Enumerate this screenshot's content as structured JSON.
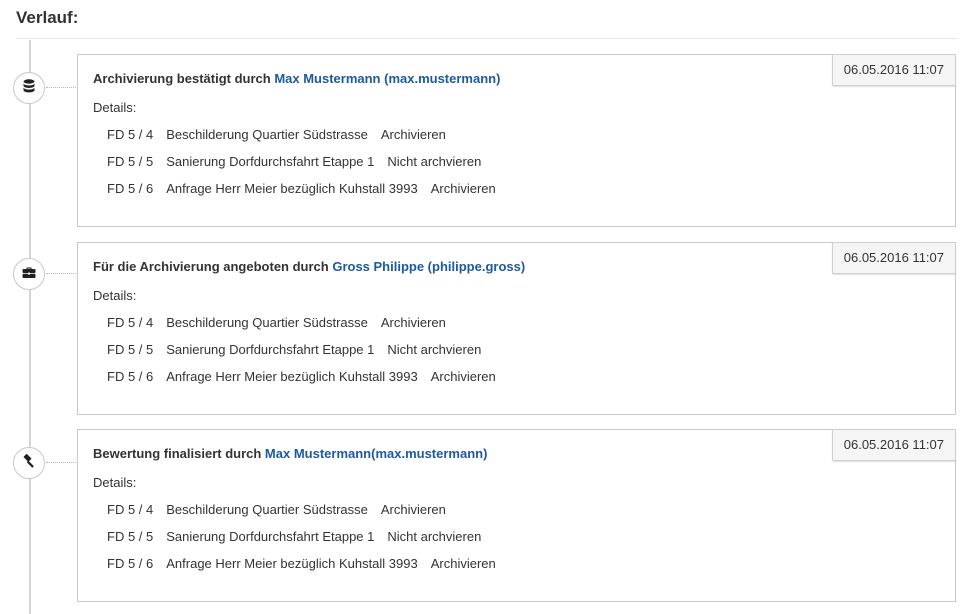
{
  "page": {
    "heading": "Verlauf:"
  },
  "entries": [
    {
      "icon": "database-icon",
      "action_text": "Archivierung bestätigt durch ",
      "user": "Max Mustermann (max.mustermann)",
      "timestamp": "06.05.2016 11:07",
      "details_label": "Details:",
      "rows": [
        {
          "code": "FD 5 / 4",
          "title": "Beschilderung Quartier Südstrasse",
          "decision": "Archivieren"
        },
        {
          "code": "FD 5 / 5",
          "title": "Sanierung Dorfdurchsfahrt Etappe 1",
          "decision": "Nicht archvieren"
        },
        {
          "code": "FD 5 / 6",
          "title": "Anfrage Herr Meier bezüglich Kuhstall 3993",
          "decision": "Archivieren"
        }
      ]
    },
    {
      "icon": "briefcase-icon",
      "action_text": "Für die Archivierung angeboten durch ",
      "user": "Gross Philippe (philippe.gross)",
      "timestamp": "06.05.2016 11:07",
      "details_label": "Details:",
      "rows": [
        {
          "code": "FD 5 / 4",
          "title": "Beschilderung Quartier Südstrasse",
          "decision": "Archivieren"
        },
        {
          "code": "FD 5 / 5",
          "title": "Sanierung Dorfdurchsfahrt Etappe 1",
          "decision": "Nicht archvieren"
        },
        {
          "code": "FD 5 / 6",
          "title": "Anfrage Herr Meier bezüglich Kuhstall 3993",
          "decision": "Archivieren"
        }
      ]
    },
    {
      "icon": "gavel-icon",
      "action_text": "Bewertung finalisiert durch ",
      "user": "Max Mustermann(max.mustermann)",
      "timestamp": "06.05.2016 11:07",
      "details_label": "Details:",
      "rows": [
        {
          "code": "FD 5 / 4",
          "title": "Beschilderung Quartier Südstrasse",
          "decision": "Archivieren"
        },
        {
          "code": "FD 5 / 5",
          "title": "Sanierung Dorfdurchsfahrt Etappe 1",
          "decision": "Nicht archvieren"
        },
        {
          "code": "FD 5 / 6",
          "title": "Anfrage Herr Meier bezüglich Kuhstall 3993",
          "decision": "Archivieren"
        }
      ]
    }
  ],
  "colors": {
    "link": "#1e5aa0",
    "border": "#c9c9c9",
    "timestamp_bg": "#f5f5f5",
    "timeline": "#d4d4d4"
  }
}
